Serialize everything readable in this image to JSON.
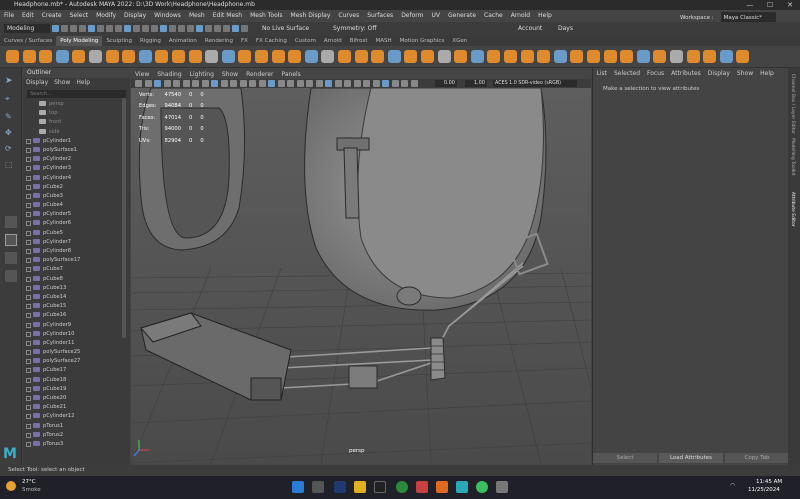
{
  "window": {
    "title": "Headphone.mb* - Autodesk MAYA 2022: D:\\3D Work\\Headphone\\Headphone.mb",
    "minimize": "—",
    "maximize": "☐",
    "close": "✕"
  },
  "menubar": [
    "File",
    "Edit",
    "Create",
    "Select",
    "Modify",
    "Display",
    "Windows",
    "Mesh",
    "Edit Mesh",
    "Mesh Tools",
    "Mesh Display",
    "Curves",
    "Surfaces",
    "Deform",
    "UV",
    "Generate",
    "Cache",
    "Arnold",
    "Help"
  ],
  "workspace": {
    "label": "Workspace :",
    "value": "Maya Classic*"
  },
  "statusline": {
    "mode": "Modeling",
    "live_surface": "No Live Surface",
    "symmetry": "Symmetry: Off",
    "account": "Account",
    "days": "Days"
  },
  "shelf_tabs": [
    "Curves / Surfaces",
    "Poly Modeling",
    "Sculpting",
    "Rigging",
    "Animation",
    "Rendering",
    "FX",
    "FX Caching",
    "Custom",
    "Arnold",
    "Bifrost",
    "MASH",
    "Motion Graphics",
    "XGen"
  ],
  "shelf_active": "Poly Modeling",
  "outliner": {
    "title": "Outliner",
    "menu": [
      "Display",
      "Show",
      "Help"
    ],
    "search_placeholder": "Search...",
    "items": [
      {
        "name": "persp",
        "type": "camera"
      },
      {
        "name": "top",
        "type": "camera"
      },
      {
        "name": "front",
        "type": "camera"
      },
      {
        "name": "side",
        "type": "camera"
      },
      {
        "name": "pCylinder1",
        "type": "mesh"
      },
      {
        "name": "polySurface1",
        "type": "mesh"
      },
      {
        "name": "pCylinder2",
        "type": "mesh"
      },
      {
        "name": "pCylinder3",
        "type": "mesh"
      },
      {
        "name": "pCylinder4",
        "type": "mesh"
      },
      {
        "name": "pCube2",
        "type": "mesh"
      },
      {
        "name": "pCube3",
        "type": "mesh"
      },
      {
        "name": "pCube4",
        "type": "mesh"
      },
      {
        "name": "pCylinder5",
        "type": "mesh"
      },
      {
        "name": "pCylinder6",
        "type": "mesh"
      },
      {
        "name": "pCube5",
        "type": "mesh"
      },
      {
        "name": "pCylinder7",
        "type": "mesh"
      },
      {
        "name": "pCylinder8",
        "type": "mesh"
      },
      {
        "name": "polySurface17",
        "type": "mesh"
      },
      {
        "name": "pCube7",
        "type": "mesh"
      },
      {
        "name": "pCube8",
        "type": "mesh"
      },
      {
        "name": "pCube13",
        "type": "mesh"
      },
      {
        "name": "pCube14",
        "type": "mesh"
      },
      {
        "name": "pCube15",
        "type": "mesh"
      },
      {
        "name": "pCube16",
        "type": "mesh"
      },
      {
        "name": "pCylinder9",
        "type": "mesh"
      },
      {
        "name": "pCylinder10",
        "type": "mesh"
      },
      {
        "name": "pCylinder11",
        "type": "mesh"
      },
      {
        "name": "polySurface25",
        "type": "mesh"
      },
      {
        "name": "polySurface27",
        "type": "mesh"
      },
      {
        "name": "pCube17",
        "type": "mesh"
      },
      {
        "name": "pCube18",
        "type": "mesh"
      },
      {
        "name": "pCube19",
        "type": "mesh"
      },
      {
        "name": "pCube20",
        "type": "mesh"
      },
      {
        "name": "pCube21",
        "type": "mesh"
      },
      {
        "name": "pCylinder12",
        "type": "mesh"
      },
      {
        "name": "pTorus1",
        "type": "mesh"
      },
      {
        "name": "pTorus2",
        "type": "mesh"
      },
      {
        "name": "pTorus3",
        "type": "mesh"
      }
    ]
  },
  "viewport": {
    "menu": [
      "View",
      "Shading",
      "Lighting",
      "Show",
      "Renderer",
      "Panels"
    ],
    "exposure": "0.00",
    "gamma": "1.00",
    "color_space": "ACES 1.0 SDR-video (sRGB)",
    "camera_label": "persp",
    "hud": [
      {
        "label": "Verts:",
        "a": "47540",
        "b": "0",
        "c": "0"
      },
      {
        "label": "Edges:",
        "a": "94084",
        "b": "0",
        "c": "0"
      },
      {
        "label": "Faces:",
        "a": "47014",
        "b": "0",
        "c": "0"
      },
      {
        "label": "Tris:",
        "a": "94000",
        "b": "0",
        "c": "0"
      },
      {
        "label": "UVs:",
        "a": "82904",
        "b": "0",
        "c": "0"
      }
    ]
  },
  "attribute_editor": {
    "menu": [
      "List",
      "Selected",
      "Focus",
      "Attributes",
      "Display",
      "Show",
      "Help"
    ],
    "message": "Make a selection to view attributes",
    "buttons": {
      "select": "Select",
      "load": "Load Attributes",
      "copy": "Copy Tab"
    }
  },
  "side_tabs": [
    "Channel Box / Layer Editor",
    "Modelling Toolkit",
    "Attribute Editor"
  ],
  "help_line": "Select Tool: select an object",
  "taskbar": {
    "weather_temp": "27°C",
    "weather_desc": "Smoke",
    "time": "11:45 AM",
    "date": "11/25/2024"
  },
  "colors": {
    "shelf_orange": "#e08a2e",
    "maya_accent": "#3ab0c8",
    "outliner_mesh": "#7a6fa8"
  }
}
